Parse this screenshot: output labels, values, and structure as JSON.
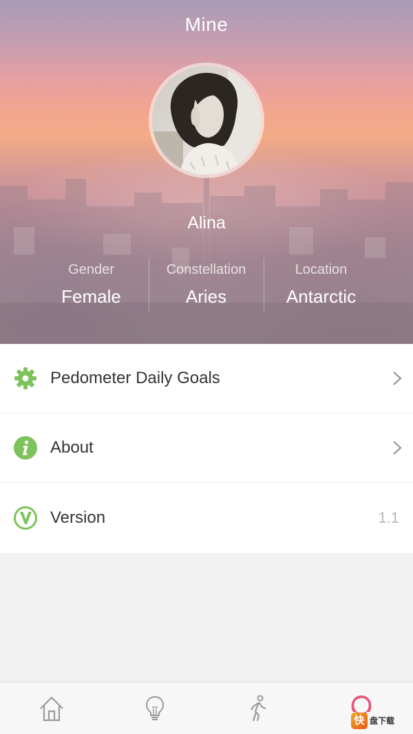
{
  "header": {
    "title": "Mine",
    "username": "Alina",
    "stats": [
      {
        "label": "Gender",
        "value": "Female"
      },
      {
        "label": "Constellation",
        "value": "Aries"
      },
      {
        "label": "Location",
        "value": "Antarctic"
      }
    ]
  },
  "menu": {
    "items": [
      {
        "label": "Pedometer Daily Goals",
        "icon": "gear-icon"
      },
      {
        "label": "About",
        "icon": "info-icon"
      },
      {
        "label": "Version",
        "icon": "version-v-icon",
        "value": "1.1"
      }
    ]
  },
  "tabbar": {
    "tabs": [
      {
        "name": "home",
        "icon": "home-icon",
        "active": false
      },
      {
        "name": "tips",
        "icon": "lightbulb-icon",
        "active": false
      },
      {
        "name": "walk",
        "icon": "walking-person-icon",
        "active": false
      },
      {
        "name": "mine",
        "icon": "female-symbol-icon",
        "active": true
      }
    ]
  },
  "watermark": {
    "glyph": "快",
    "text": "盘下载"
  },
  "colors": {
    "accent_green": "#7dc25a",
    "active_tab": "#e8547a",
    "inactive_tab": "#9a9a9a"
  }
}
